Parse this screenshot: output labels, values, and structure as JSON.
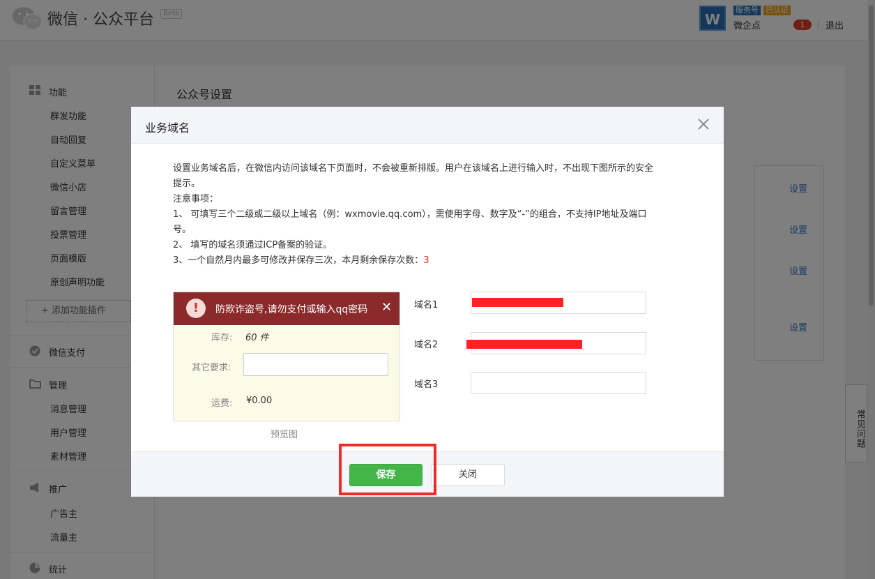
{
  "header": {
    "logo_text": "微信 · 公众平台",
    "beta_badge": "Beta",
    "avatar_letter": "W",
    "badge_service": "服务号",
    "badge_verified": "已认证",
    "account_name": "微企点",
    "notification_count": "1",
    "logout_label": "退出"
  },
  "sidebar": {
    "groups": [
      {
        "label": "功能",
        "icon": "grid-icon"
      },
      {
        "label": "微信支付",
        "icon": "check-circle-icon"
      },
      {
        "label": "管理",
        "icon": "folder-icon"
      },
      {
        "label": "推广",
        "icon": "megaphone-icon"
      },
      {
        "label": "统计",
        "icon": "pie-chart-icon"
      }
    ],
    "feature_items": [
      "群发功能",
      "自动回复",
      "自定义菜单",
      "微信小店",
      "留言管理",
      "投票管理",
      "页面模版",
      "原创声明功能"
    ],
    "add_plugin_label": "添加功能插件",
    "manage_items": [
      "消息管理",
      "用户管理",
      "素材管理"
    ],
    "promo_items": [
      "广告主",
      "流量主"
    ]
  },
  "main": {
    "title": "公众号设置",
    "set_links": [
      "设置",
      "设置",
      "设置",
      "设置"
    ]
  },
  "faq_label": "常见问题",
  "dialog": {
    "title": "业务域名",
    "desc_line1": "设置业务域名后，在微信内访问该域名下页面时，不会被重新排版。用户在该域名上进行输入时，不出现下图所示的安全",
    "desc_line2": "提示。",
    "notes_title": "注意事项：",
    "note1_line1": "1、 可填写三个二级或二级以上域名（例：wxmovie.qq.com），需使用字母、数字及“-”的组合，不支持IP地址及端口",
    "note1_line2": "号。",
    "note2": "2、 填写的域名须通过ICP备案的验证。",
    "note3_prefix": "3、一个自然月内最多可修改并保存三次，本月剩余保存次数：",
    "note3_count": "3",
    "preview": {
      "warning_text": "防欺诈盗号,请勿支付或输入qq密码",
      "stock_label": "库存:",
      "stock_value": "60 件",
      "other_label": "其它要求:",
      "shipping_label": "运费:",
      "shipping_value": "¥0.00",
      "caption": "预览图"
    },
    "domains": [
      {
        "label": "域名1",
        "value": ""
      },
      {
        "label": "域名2",
        "value": ""
      },
      {
        "label": "域名3",
        "value": ""
      }
    ],
    "save_label": "保存",
    "close_label": "关闭"
  },
  "colors": {
    "accent_green": "#44b549",
    "warning_red": "#8b2a2a",
    "highlight_red": "#ee2a2a",
    "link_blue": "#3a72c9"
  }
}
